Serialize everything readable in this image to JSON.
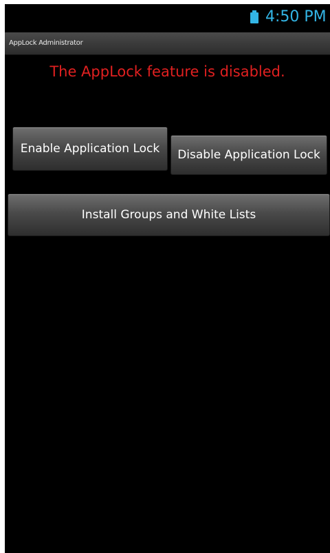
{
  "status_bar": {
    "time": "4:50 PM",
    "battery_icon": "battery-icon"
  },
  "app": {
    "title": "AppLock Administrator"
  },
  "main": {
    "status_message": "The AppLock feature is disabled.",
    "enable_button_label": "Enable Application Lock",
    "disable_button_label": "Disable Application Lock",
    "install_button_label": "Install Groups and White Lists"
  },
  "colors": {
    "status_text": "#e02020",
    "status_bar_accent": "#33b5e5",
    "background": "#000000"
  }
}
